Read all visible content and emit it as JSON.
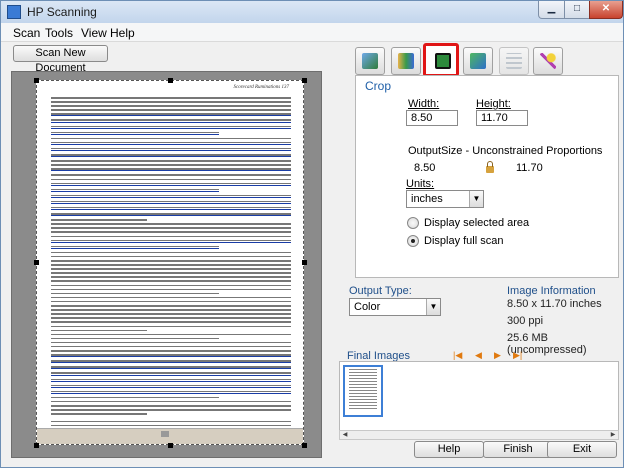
{
  "window": {
    "title": "HP Scanning"
  },
  "menu": [
    "Scan",
    "Tools",
    "View",
    "Help"
  ],
  "scan_new_label": "Scan New Document",
  "document": {
    "header": "Scorecard Ruminations  137"
  },
  "crop": {
    "title": "Crop",
    "width_label": "Width:",
    "width_value": "8.50",
    "height_label": "Height:",
    "height_value": "11.70",
    "output_size_label": "OutputSize  -  Unconstrained Proportions",
    "output_w": "8.50",
    "output_h": "11.70",
    "units_label": "Units:",
    "units_value": "inches",
    "display_selected": "Display selected area",
    "display_full": "Display full scan"
  },
  "output_type": {
    "label": "Output Type:",
    "value": "Color"
  },
  "image_info": {
    "title": "Image Information",
    "dimensions": "8.50 x 11.70 inches",
    "dpi": "300 ppi",
    "size": "25.6 MB (uncompressed)"
  },
  "final_images": {
    "label": "Final Images"
  },
  "buttons": {
    "help": "Help",
    "finish": "Finish",
    "exit": "Exit"
  },
  "icons": {
    "tools": [
      "scan-photo-icon",
      "color-adjust-icon",
      "crop-icon",
      "resize-icon",
      "sliders-icon",
      "magic-wand-icon"
    ],
    "active_tool": "crop-icon"
  },
  "colors": {
    "accent": "#1f5fa8",
    "active_tool_border": "#e01515",
    "nav_arrows": "#e07a10"
  }
}
